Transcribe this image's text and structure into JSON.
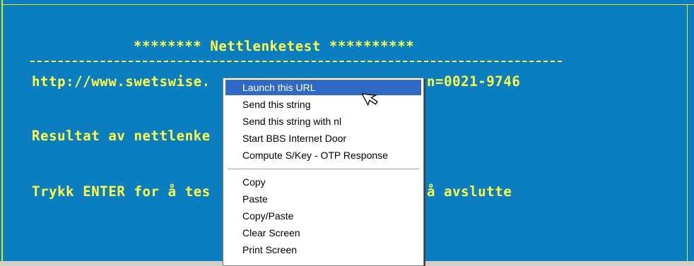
{
  "terminal": {
    "title_line": "******** Nettlenketest **********",
    "url_line_left": "http://www.swetswise.",
    "url_line_right": "n=0021-9746",
    "result_line": "Resultat av nettlenke",
    "prompt_left": "Trykk ENTER for å tes",
    "prompt_right": "å avslutte",
    "colors": {
      "background": "#0b7ec0",
      "text": "#ffff4a"
    }
  },
  "context_menu": {
    "items": [
      {
        "label": "Launch this URL",
        "highlighted": true
      },
      {
        "label": "Send this string"
      },
      {
        "label": "Send this string with nl"
      },
      {
        "label": "Start BBS Internet Door"
      },
      {
        "label": "Compute S/Key - OTP Response"
      },
      {
        "label": "Copy"
      },
      {
        "label": "Paste"
      },
      {
        "label": "Copy/Paste"
      },
      {
        "label": "Clear Screen"
      },
      {
        "label": "Print Screen"
      }
    ],
    "highlight_color": "#316ac5"
  },
  "cursor": {
    "icon": "pointer-arrow-icon"
  }
}
